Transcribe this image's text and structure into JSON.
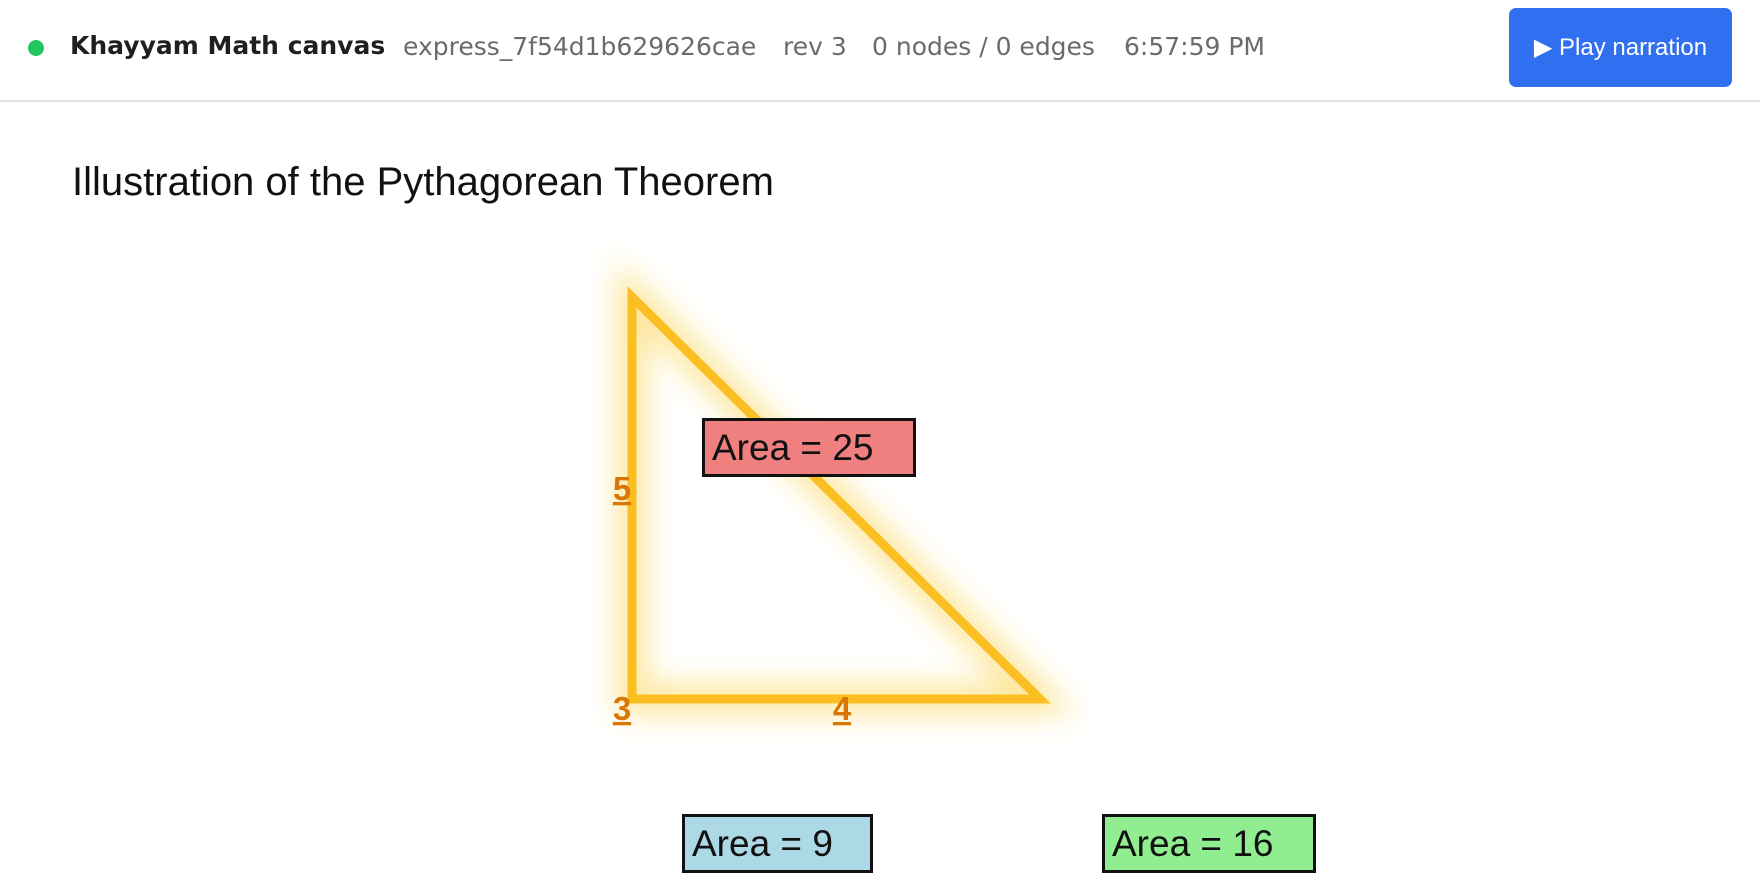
{
  "header": {
    "status": "connected",
    "app_title": "Khayyam Math canvas",
    "session_id": "express_7f54d1b629626cae",
    "revision": "rev 3",
    "graph_counts": "0 nodes / 0 edges",
    "time": "6:57:59 PM",
    "play_button_label": "▶ Play narration"
  },
  "canvas": {
    "title": "Illustration of the Pythagorean Theorem",
    "triangle": {
      "stroke_color": "#fbbf24",
      "label_color": "#d97706",
      "side_labels": [
        "5",
        "3",
        "4"
      ]
    },
    "area_boxes": [
      {
        "label": "Area = 25",
        "color": "#f08080"
      },
      {
        "label": "Area = 9",
        "color": "#add8e6"
      },
      {
        "label": "Area = 16",
        "color": "#90ee90"
      }
    ]
  },
  "colors": {
    "accent": "#2f6ff0",
    "status_ok": "#22c55e"
  }
}
